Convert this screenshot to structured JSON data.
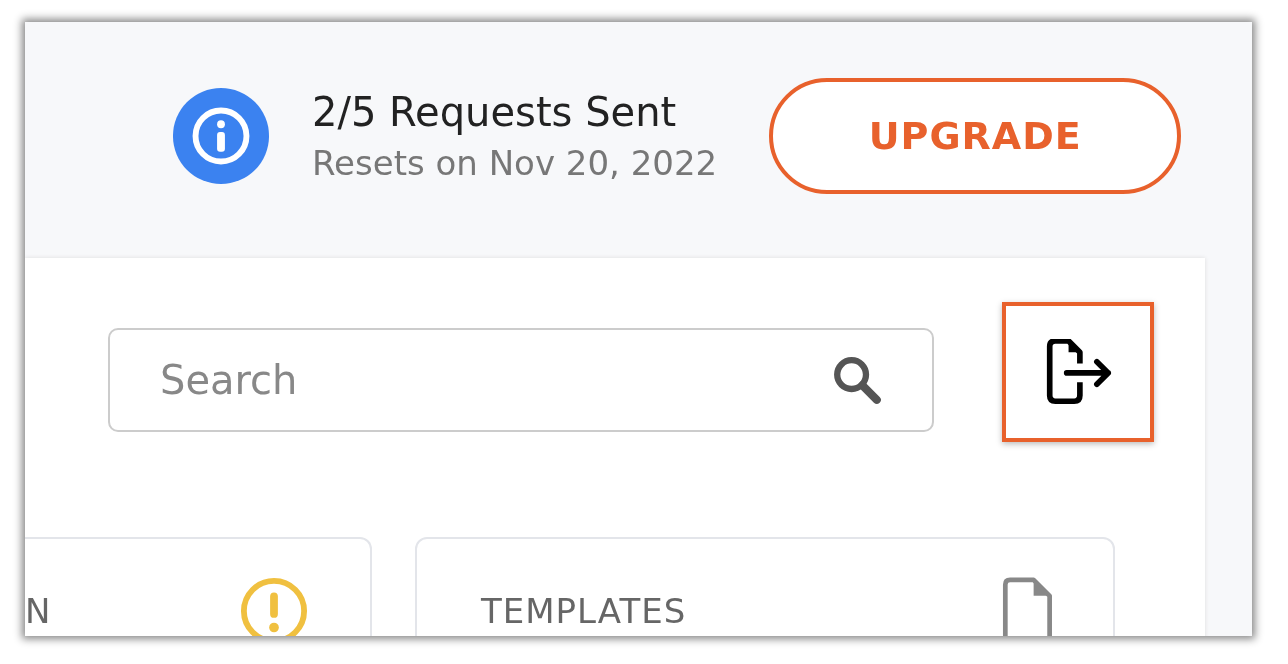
{
  "usage": {
    "title": "2/5 Requests Sent",
    "subtitle": "Resets on Nov 20, 2022"
  },
  "upgrade_button": {
    "label": "UPGRADE"
  },
  "search": {
    "placeholder": "Search"
  },
  "cards": [
    {
      "title": "N",
      "kind": "warning"
    },
    {
      "title": "TEMPLATES",
      "kind": "document"
    }
  ]
}
